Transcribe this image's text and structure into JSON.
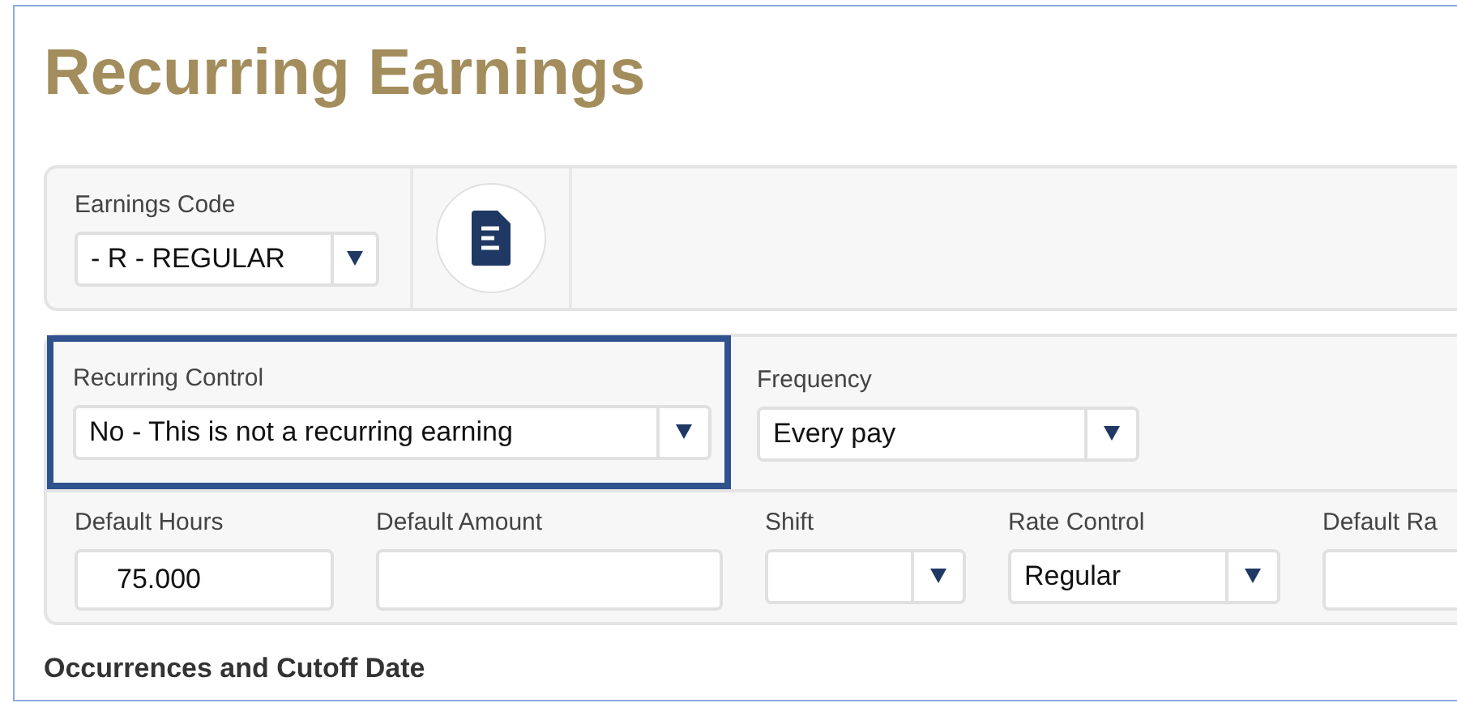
{
  "title": "Recurring Earnings",
  "earnings": {
    "label": "Earnings Code",
    "value": "- R - REGULAR"
  },
  "control_row": [
    {
      "label": "Recurring Control",
      "value": "No - This is not a recurring earning",
      "kind": "select",
      "highlighted": true
    },
    {
      "label": "Frequency",
      "value": "Every pay",
      "kind": "select",
      "highlighted": false
    }
  ],
  "defaults_row": [
    {
      "label": "Default Hours",
      "value": "75.000",
      "kind": "text"
    },
    {
      "label": "Default Amount",
      "kind": "text"
    },
    {
      "label": "Shift",
      "kind": "select"
    },
    {
      "label": "Rate Control",
      "value": "Regular",
      "kind": "select"
    },
    {
      "label": "Default Ra",
      "kind": "text"
    }
  ],
  "section_heading": "Occurrences and Cutoff Date"
}
